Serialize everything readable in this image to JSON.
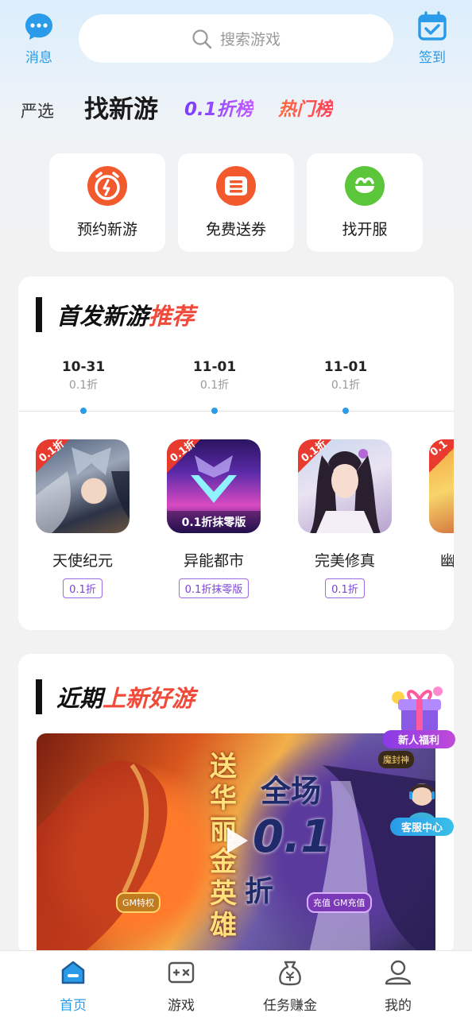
{
  "header": {
    "messages_label": "消息",
    "search_placeholder": "搜索游戏",
    "checkin_label": "签到"
  },
  "tabs": [
    "严选",
    "找新游",
    "0.1折榜",
    "热门榜"
  ],
  "quick_actions": [
    {
      "label": "预约新游",
      "icon": "alarm-clock-icon",
      "color": "#f25a2e"
    },
    {
      "label": "免费送券",
      "icon": "coupon-icon",
      "color": "#f25a2e"
    },
    {
      "label": "找开服",
      "icon": "server-gift-icon",
      "color": "#5cc63a"
    }
  ],
  "new_games_section": {
    "title_main": "首发新游",
    "title_accent": "推荐",
    "timeline": [
      {
        "date": "10-31",
        "discount": "0.1折"
      },
      {
        "date": "11-01",
        "discount": "0.1折"
      },
      {
        "date": "11-01",
        "discount": "0.1折"
      }
    ],
    "games": [
      {
        "name": "天使纪元",
        "tag": "0.1折",
        "badge": "0.1折"
      },
      {
        "name": "异能都市",
        "tag": "0.1折抹零版",
        "badge": "0.1折",
        "art_label": "0.1折抹零版"
      },
      {
        "name": "完美修真",
        "tag": "0.1折",
        "badge": "0.1折"
      },
      {
        "name": "幽蓝",
        "badge": "0.1"
      }
    ]
  },
  "recent_section": {
    "title_main": "近期",
    "title_accent": "上新好游",
    "video": {
      "left_text": "送华丽金英雄",
      "right_text_top": "全场",
      "right_text_mid": "0.1",
      "right_text_bottom": "折",
      "left_badge": "GM特权",
      "right_badge": "充值 GM充值",
      "corner_text": "魔封神"
    }
  },
  "floating": {
    "welfare_label": "新人福利",
    "service_label": "客服中心"
  },
  "bottom_nav": [
    {
      "label": "首页",
      "icon": "home-icon",
      "active": true
    },
    {
      "label": "游戏",
      "icon": "gamepad-icon",
      "active": false
    },
    {
      "label": "任务赚金",
      "icon": "money-bag-icon",
      "active": false
    },
    {
      "label": "我的",
      "icon": "profile-icon",
      "active": false
    }
  ],
  "colors": {
    "accent_blue": "#2a9be8",
    "accent_red": "#f04a3a",
    "tag_purple": "#7a42d8"
  }
}
